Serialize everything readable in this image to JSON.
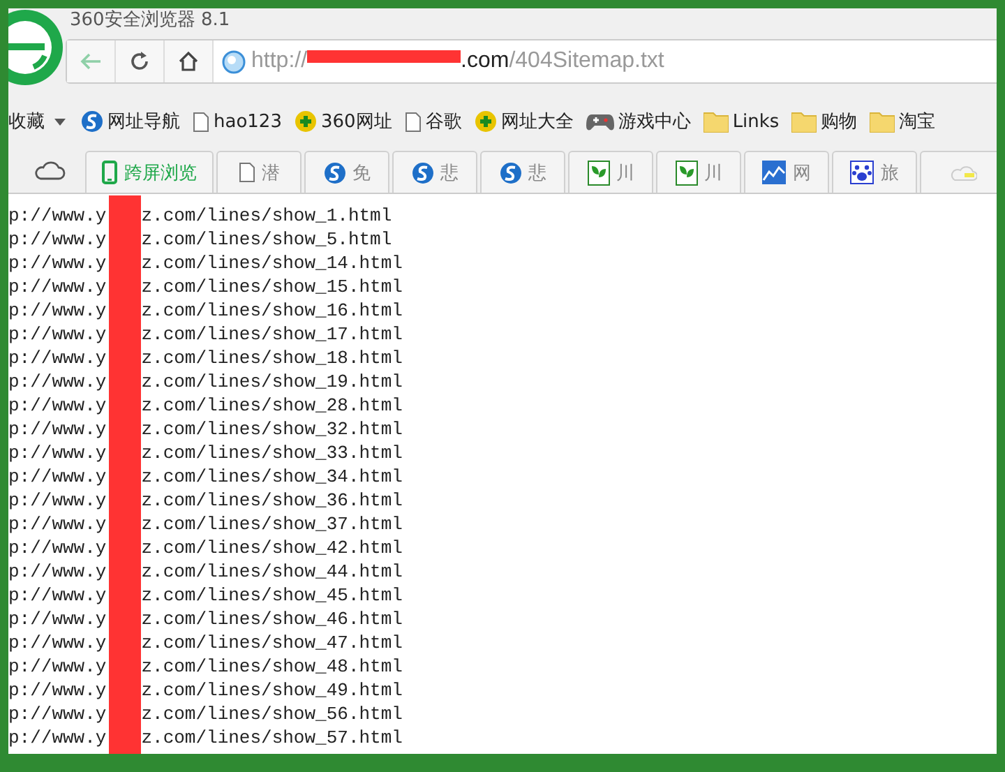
{
  "window": {
    "title": "360安全浏览器 8.1"
  },
  "address_bar": {
    "url_start": "http://",
    "url_host_end": ".com",
    "url_path": "/404Sitemap.txt"
  },
  "bookmarks": [
    {
      "label": "收藏",
      "kind": "menu"
    },
    {
      "label": "网址导航",
      "kind": "swirl"
    },
    {
      "label": "hao123",
      "kind": "page"
    },
    {
      "label": "360网址",
      "kind": "plus"
    },
    {
      "label": "谷歌",
      "kind": "page"
    },
    {
      "label": "网址大全",
      "kind": "plus"
    },
    {
      "label": "游戏中心",
      "kind": "gamepad"
    },
    {
      "label": "Links",
      "kind": "folder"
    },
    {
      "label": "购物",
      "kind": "folder"
    },
    {
      "label": "淘宝",
      "kind": "folder"
    }
  ],
  "cross_screen_button": {
    "label": "跨屏浏览"
  },
  "tabs": [
    {
      "label": "潜",
      "kind": "page"
    },
    {
      "label": "免",
      "kind": "swirl"
    },
    {
      "label": "悲",
      "kind": "swirl"
    },
    {
      "label": "悲",
      "kind": "swirl"
    },
    {
      "label": "川",
      "kind": "leaf"
    },
    {
      "label": "川",
      "kind": "leaf"
    },
    {
      "label": "网",
      "kind": "chart"
    },
    {
      "label": "旅",
      "kind": "paw"
    },
    {
      "kind": "cloud"
    }
  ],
  "lines": [
    {
      "before": "p://www.y",
      "after": "z.com/lines/show_1.html"
    },
    {
      "before": "p://www.y",
      "after": "z.com/lines/show_5.html"
    },
    {
      "before": "p://www.y",
      "after": "z.com/lines/show_14.html"
    },
    {
      "before": "p://www.y",
      "after": "z.com/lines/show_15.html"
    },
    {
      "before": "p://www.y",
      "after": "z.com/lines/show_16.html"
    },
    {
      "before": "p://www.y",
      "after": "z.com/lines/show_17.html"
    },
    {
      "before": "p://www.y",
      "after": "z.com/lines/show_18.html"
    },
    {
      "before": "p://www.y",
      "after": "z.com/lines/show_19.html"
    },
    {
      "before": "p://www.y",
      "after": "z.com/lines/show_28.html"
    },
    {
      "before": "p://www.y",
      "after": "z.com/lines/show_32.html"
    },
    {
      "before": "p://www.y",
      "after": "z.com/lines/show_33.html"
    },
    {
      "before": "p://www.y",
      "after": "z.com/lines/show_34.html"
    },
    {
      "before": "p://www.y",
      "after": "z.com/lines/show_36.html"
    },
    {
      "before": "p://www.y",
      "after": "z.com/lines/show_37.html"
    },
    {
      "before": "p://www.y",
      "after": "z.com/lines/show_42.html"
    },
    {
      "before": "p://www.y",
      "after": "z.com/lines/show_44.html"
    },
    {
      "before": "p://www.y",
      "after": "z.com/lines/show_45.html"
    },
    {
      "before": "p://www.y",
      "after": "z.com/lines/show_46.html"
    },
    {
      "before": "p://www.y",
      "after": "z.com/lines/show_47.html"
    },
    {
      "before": "p://www.y",
      "after": "z.com/lines/show_48.html"
    },
    {
      "before": "p://www.y",
      "after": "z.com/lines/show_49.html"
    },
    {
      "before": "p://www.y",
      "after": "z.com/lines/show_56.html"
    },
    {
      "before": "p://www.y",
      "after": "z.com/lines/show_57.html"
    }
  ]
}
